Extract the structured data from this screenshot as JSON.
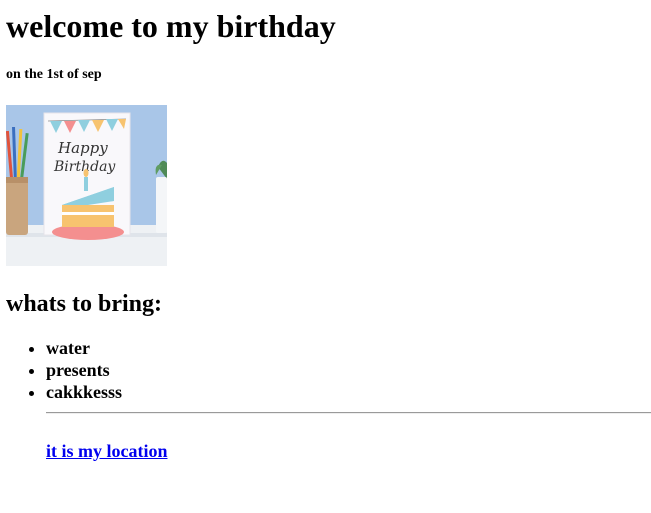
{
  "page": {
    "title": "welcome to my birthday",
    "date": "on the 1st of sep"
  },
  "card_image": {
    "card_text_line1": "Happy",
    "card_text_line2": "Birthday"
  },
  "bring_section": {
    "heading": "whats to bring:",
    "items": [
      {
        "label": "water"
      },
      {
        "label": "presents"
      },
      {
        "label": "cakkkesss"
      }
    ]
  },
  "location_link": {
    "label": "it is my location"
  },
  "colors": {
    "link": "#0000ee",
    "background_wall": "#a9c6e8",
    "cake_frosting": "#8fcfdf",
    "cake_body": "#f7c36f",
    "plate": "#f48f8f"
  }
}
